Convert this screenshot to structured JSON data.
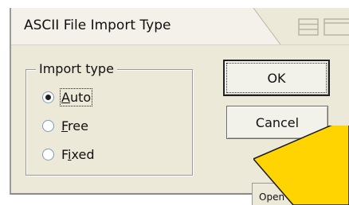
{
  "window": {
    "title": "ASCII File Import Type"
  },
  "import_type": {
    "legend": "Import type",
    "options": [
      {
        "label_pre": "",
        "label_mnemonic": "A",
        "label_post": "uto",
        "selected": true,
        "focused": true
      },
      {
        "label_pre": "",
        "label_mnemonic": "F",
        "label_post": "ree",
        "selected": false,
        "focused": false
      },
      {
        "label_pre": "F",
        "label_mnemonic": "i",
        "label_post": "xed",
        "selected": false,
        "focused": false
      }
    ]
  },
  "buttons": {
    "ok_label": "OK",
    "cancel_label": "Cancel"
  },
  "footer": {
    "tab_label": "Open Text Fi"
  },
  "colors": {
    "dialog_bg": "#ece9d8",
    "highlight_note": "#ffd400"
  },
  "icons": {
    "tile_icon": "tile-windows-icon",
    "restore_icon": "restore-window-icon"
  }
}
